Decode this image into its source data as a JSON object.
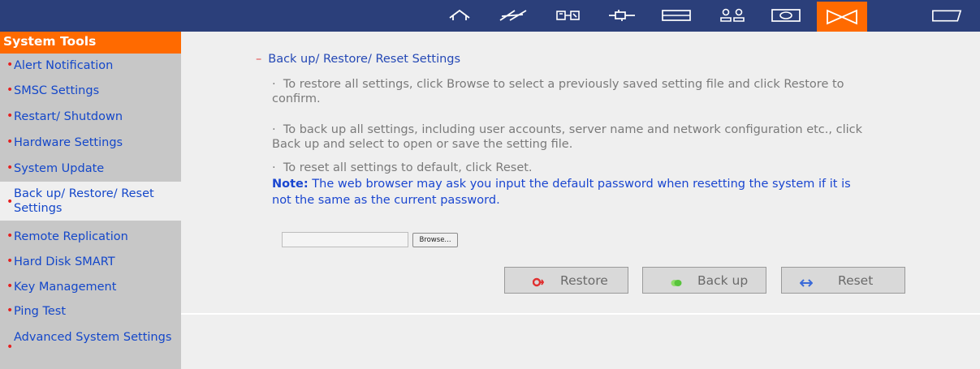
{
  "topbar": {
    "icons": [
      "home-icon",
      "network-icon",
      "device-icon",
      "plug-icon",
      "disk-icon",
      "users-icon",
      "monitor-icon",
      "system-tools-icon",
      "folder-icon"
    ],
    "bg_color": "#2b3f7a",
    "active_color": "#ff6a00"
  },
  "sidebar": {
    "title": "System Tools",
    "items": [
      {
        "label": "Alert Notification"
      },
      {
        "label": "SMSC Settings"
      },
      {
        "label": "Restart/ Shutdown"
      },
      {
        "label": "Hardware Settings"
      },
      {
        "label": "System Update"
      },
      {
        "label": "Back up/ Restore/ Reset Settings"
      },
      {
        "label": "Remote Replication"
      },
      {
        "label": "Hard Disk SMART"
      },
      {
        "label": "Key Management"
      },
      {
        "label": "Ping Test"
      },
      {
        "label": "Advanced System Settings"
      }
    ]
  },
  "main": {
    "section_title": "Back up/ Restore/ Reset Settings",
    "restore_text": "To restore all settings, click Browse to select a previously saved setting file and click Restore to confirm.",
    "backup_text": "To back up all settings, including user accounts, server name and network configuration etc., click Back up and select to open or save the setting file.",
    "reset_text": "To reset all settings to default, click Reset.",
    "note_label": "Note:",
    "note_text": "The web browser may ask you input the default password when resetting the system if it is not the same as the current password.",
    "file_input_value": "",
    "browse_label": "Browse...",
    "buttons": {
      "restore": "Restore",
      "backup": "Back up",
      "reset": "Reset"
    }
  }
}
